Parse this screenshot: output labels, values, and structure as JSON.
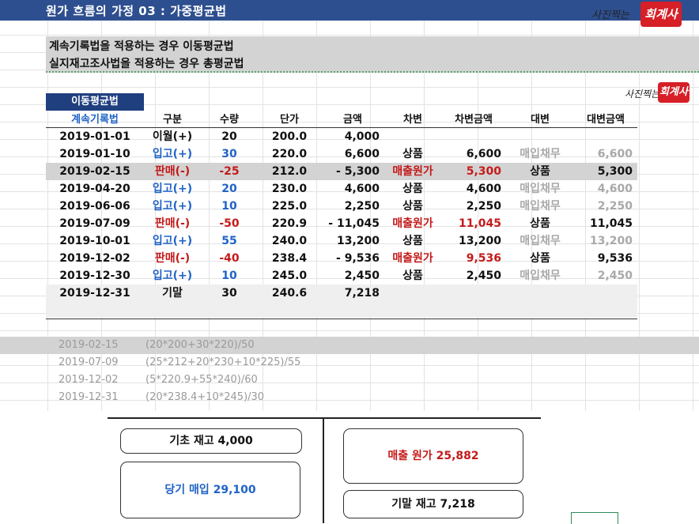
{
  "header": {
    "title": "원가 흐름의 가정 03 : 가중평균법",
    "logo_text": "회계사",
    "logo_pre": "사진찍는"
  },
  "statements": [
    "계속기록법을 적용하는 경우 이동평균법",
    "실지재고조사법을 적용하는 경우 총평균법"
  ],
  "method_tag": "이동평균법",
  "columns": [
    "계속기록법",
    "구분",
    "수량",
    "단가",
    "금액",
    "차변",
    "차변금액",
    "대변",
    "대변금액"
  ],
  "rows": [
    {
      "date": "2019-01-01",
      "type": "이월(+)",
      "kind": "carry",
      "qty": "20",
      "price": "200.0",
      "amount": "4,000",
      "debit": "",
      "debit_amt": "",
      "credit": "",
      "credit_amt": ""
    },
    {
      "date": "2019-01-10",
      "type": "입고(+)",
      "kind": "in",
      "qty": "30",
      "price": "220.0",
      "amount": "6,600",
      "debit": "상품",
      "debit_amt": "6,600",
      "credit": "매입채무",
      "credit_amt": "6,600"
    },
    {
      "date": "2019-02-15",
      "type": "판매(-)",
      "kind": "sale",
      "qty": "-25",
      "price": "212.0",
      "amount": "-  5,300",
      "debit": "매출원가",
      "debit_amt": "5,300",
      "credit": "상품",
      "credit_amt": "5,300"
    },
    {
      "date": "2019-04-20",
      "type": "입고(+)",
      "kind": "in",
      "qty": "20",
      "price": "230.0",
      "amount": "4,600",
      "debit": "상품",
      "debit_amt": "4,600",
      "credit": "매입채무",
      "credit_amt": "4,600"
    },
    {
      "date": "2019-06-06",
      "type": "입고(+)",
      "kind": "in",
      "qty": "10",
      "price": "225.0",
      "amount": "2,250",
      "debit": "상품",
      "debit_amt": "2,250",
      "credit": "매입채무",
      "credit_amt": "2,250"
    },
    {
      "date": "2019-07-09",
      "type": "판매(-)",
      "kind": "sale",
      "qty": "-50",
      "price": "220.9",
      "amount": "-  11,045",
      "debit": "매출원가",
      "debit_amt": "11,045",
      "credit": "상품",
      "credit_amt": "11,045"
    },
    {
      "date": "2019-10-01",
      "type": "입고(+)",
      "kind": "in",
      "qty": "55",
      "price": "240.0",
      "amount": "13,200",
      "debit": "상품",
      "debit_amt": "13,200",
      "credit": "매입채무",
      "credit_amt": "13,200"
    },
    {
      "date": "2019-12-02",
      "type": "판매(-)",
      "kind": "sale",
      "qty": "-40",
      "price": "238.4",
      "amount": "-  9,536",
      "debit": "매출원가",
      "debit_amt": "9,536",
      "credit": "상품",
      "credit_amt": "9,536"
    },
    {
      "date": "2019-12-30",
      "type": "입고(+)",
      "kind": "in",
      "qty": "10",
      "price": "245.0",
      "amount": "2,450",
      "debit": "상품",
      "debit_amt": "2,450",
      "credit": "매입채무",
      "credit_amt": "2,450"
    },
    {
      "date": "2019-12-31",
      "type": "기말",
      "kind": "end",
      "qty": "30",
      "price": "240.6",
      "amount": "7,218",
      "debit": "",
      "debit_amt": "",
      "credit": "",
      "credit_amt": ""
    }
  ],
  "calc_rows": [
    {
      "date": "2019-02-15",
      "formula": "(20*200+30*220)/50"
    },
    {
      "date": "2019-07-09",
      "formula": "(25*212+20*230+10*225)/55"
    },
    {
      "date": "2019-12-02",
      "formula": "(5*220.9+55*240)/60"
    },
    {
      "date": "2019-12-31",
      "formula": "(20*238.4+10*245)/30"
    }
  ],
  "t_account": {
    "beginning": "기초 재고 4,000",
    "purchases": "당기 매입 29,100",
    "cogs": "매출 원가 25,882",
    "ending": "기말 재고 7,218"
  },
  "colors": {
    "title_bar": "#2e4f8f",
    "tag": "#1f3f7f",
    "red": "#c41a1a",
    "blue": "#1f63c6",
    "logo": "#d61f26"
  }
}
